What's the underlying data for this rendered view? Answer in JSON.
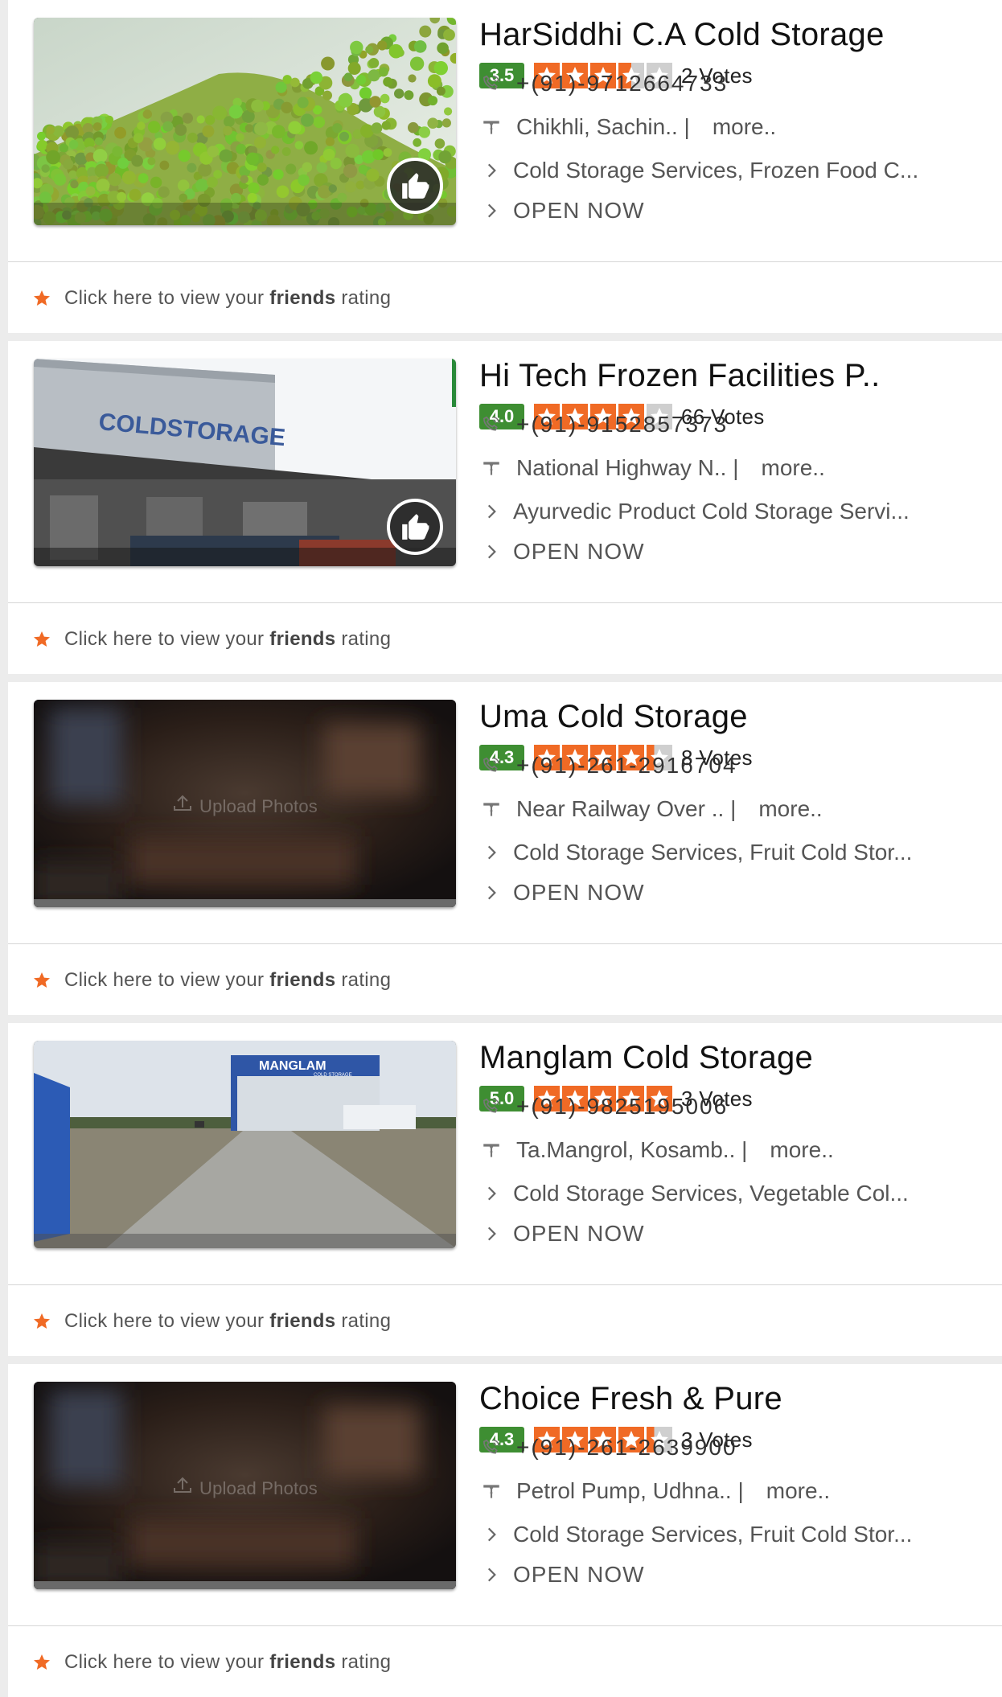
{
  "listings": [
    {
      "name": "HarSiddhi C.A Cold Storage",
      "rating": "3.5",
      "stars": 3.5,
      "votes": "2 Votes",
      "phone": "+(91)-9712664733",
      "address": "Chikhli, Sachin.. |",
      "more": "more..",
      "categories": "Cold Storage Services, Frozen Food C...",
      "status": "OPEN NOW",
      "image": "green-peas-photo",
      "has_like_badge": true,
      "upload_label": ""
    },
    {
      "name": "Hi Tech Frozen Facilities P..",
      "rating": "4.0",
      "stars": 4.0,
      "votes": "66 Votes",
      "phone": "+(91)-9152857373",
      "address": "National Highway N.. |",
      "more": "more..",
      "categories": "Ayurvedic Product Cold Storage Servi...",
      "status": "OPEN NOW",
      "image": "cold-storage-building-photo",
      "has_like_badge": true,
      "upload_label": ""
    },
    {
      "name": "Uma Cold Storage",
      "rating": "4.3",
      "stars": 4.3,
      "votes": "8 Votes",
      "phone": "+(91)-261-2916704",
      "address": "Near Railway Over .. |",
      "more": "more..",
      "categories": "Cold Storage Services, Fruit Cold Stor...",
      "status": "OPEN NOW",
      "image": "blurred-placeholder",
      "has_like_badge": false,
      "upload_label": "Upload Photos"
    },
    {
      "name": "Manglam Cold Storage",
      "rating": "5.0",
      "stars": 5.0,
      "votes": "3 Votes",
      "phone": "+(91)-9825195006",
      "address": "Ta.Mangrol, Kosamb.. |",
      "more": "more..",
      "categories": "Cold Storage Services, Vegetable Col...",
      "status": "OPEN NOW",
      "image": "manglam-warehouse-photo",
      "has_like_badge": false,
      "upload_label": "",
      "sign_text": "MANGLAM",
      "sign_subtext": "COLD STORAGE"
    },
    {
      "name": "Choice Fresh & Pure",
      "rating": "4.3",
      "stars": 4.3,
      "votes": "3 Votes",
      "phone": "+(91)-261-2639900",
      "address": "Petrol Pump, Udhna.. |",
      "more": "more..",
      "categories": "Cold Storage Services, Fruit Cold Stor...",
      "status": "OPEN NOW",
      "image": "blurred-placeholder",
      "has_like_badge": false,
      "upload_label": "Upload Photos"
    }
  ],
  "friends_rating": {
    "prefix": "Click here to view your ",
    "bold": "friends",
    "suffix": " rating"
  },
  "building_sign": "COLDSTORAGE",
  "colors": {
    "rating_green": "#3e8e32",
    "star_orange": "#f06a25",
    "star_empty": "#cfcfcf",
    "accent_star": "#f06a25"
  },
  "icons": [
    "phone-icon",
    "map-pin-icon",
    "chevron-right-icon",
    "thumbs-up-icon",
    "star-icon",
    "upload-icon"
  ]
}
